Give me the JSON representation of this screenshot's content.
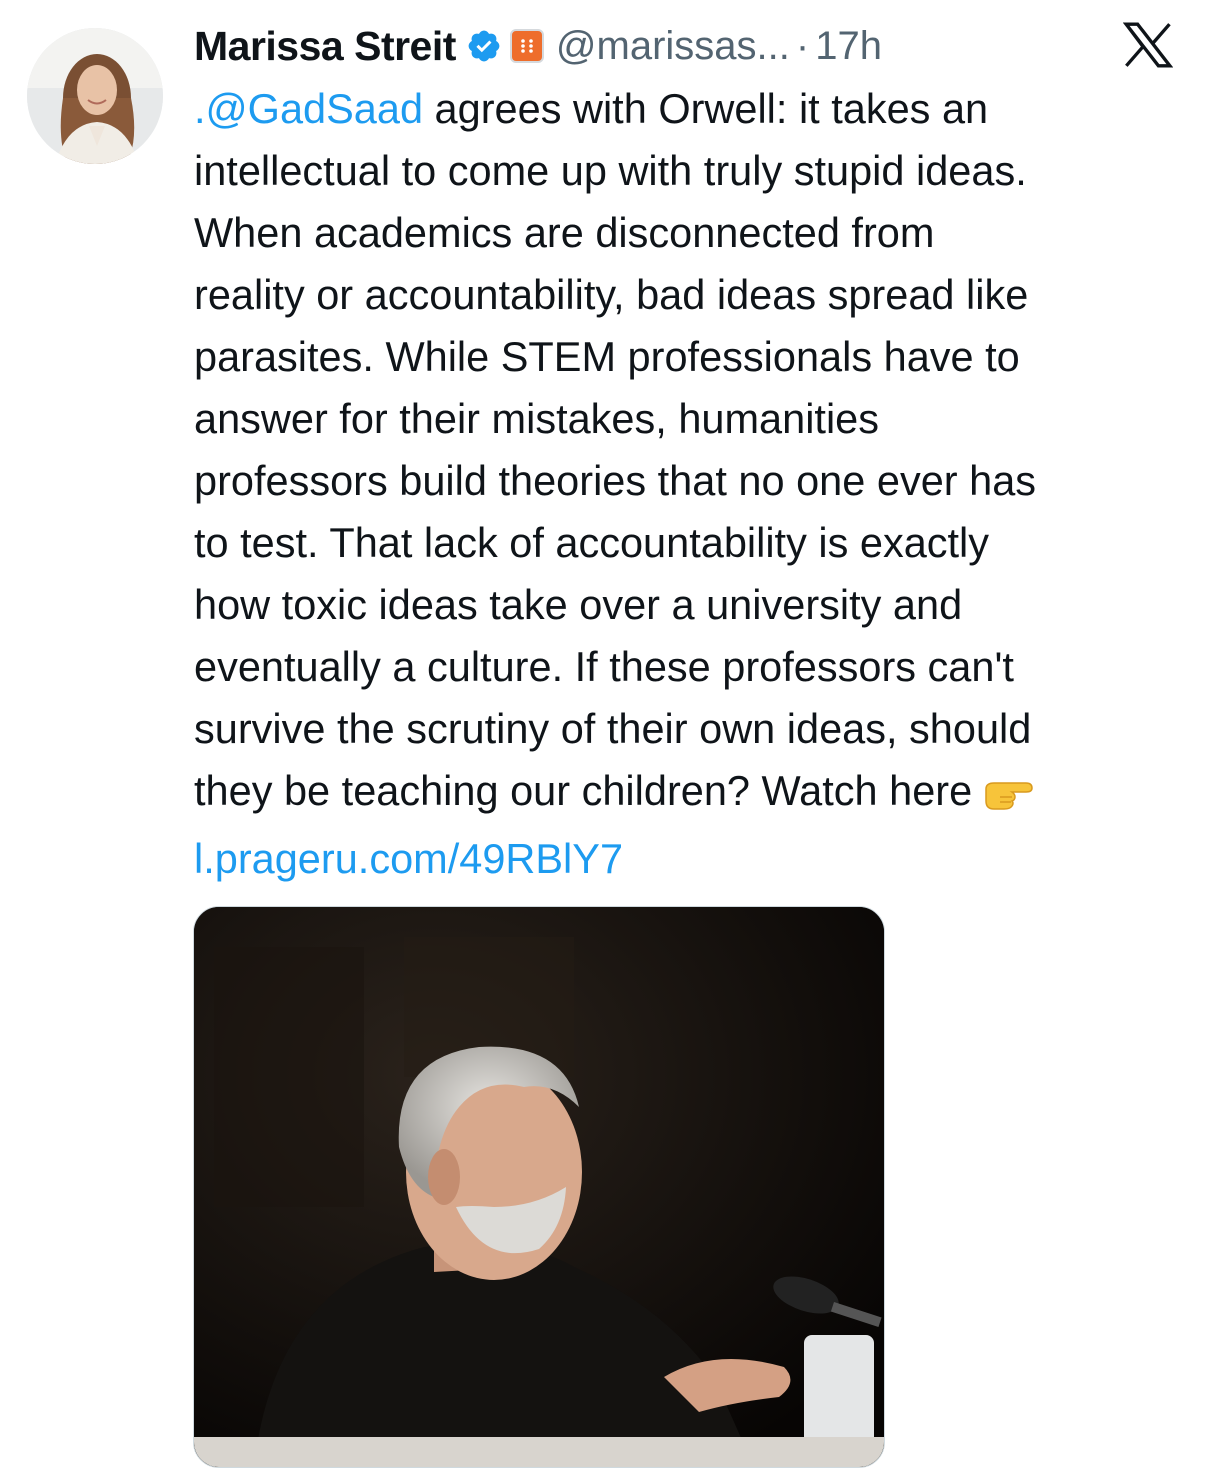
{
  "tweet": {
    "author_name": "Marissa Streit",
    "handle": "@marissas...",
    "separator": "·",
    "time": "17h",
    "mention": ".@GadSaad",
    "text_lines": [
      " agrees with Orwell: it takes an",
      "intellectual to come up with truly stupid ideas.",
      "When academics are disconnected from",
      "reality or accountability, bad ideas spread like",
      "parasites. While STEM professionals have to",
      "answer for their mistakes, humanities",
      "professors build theories that no one ever has",
      "to test. That lack of accountability is exactly",
      "how toxic ideas take over a university and",
      "eventually a culture. If these professors can't",
      "survive the scrutiny of their own ideas, should",
      "they be teaching our children? Watch here"
    ],
    "link": "l.prageru.com/49RBlY7",
    "emoji": "pointing-right-hand-icon"
  },
  "icons": {
    "verified": "verified-badge-icon",
    "affiliate": "affiliate-badge-icon",
    "platform": "x-logo-icon"
  },
  "colors": {
    "text": "#0f1419",
    "secondary": "#536471",
    "link": "#1d9bf0",
    "verified": "#1d9bf0",
    "affiliate": "#ee6d2b"
  }
}
